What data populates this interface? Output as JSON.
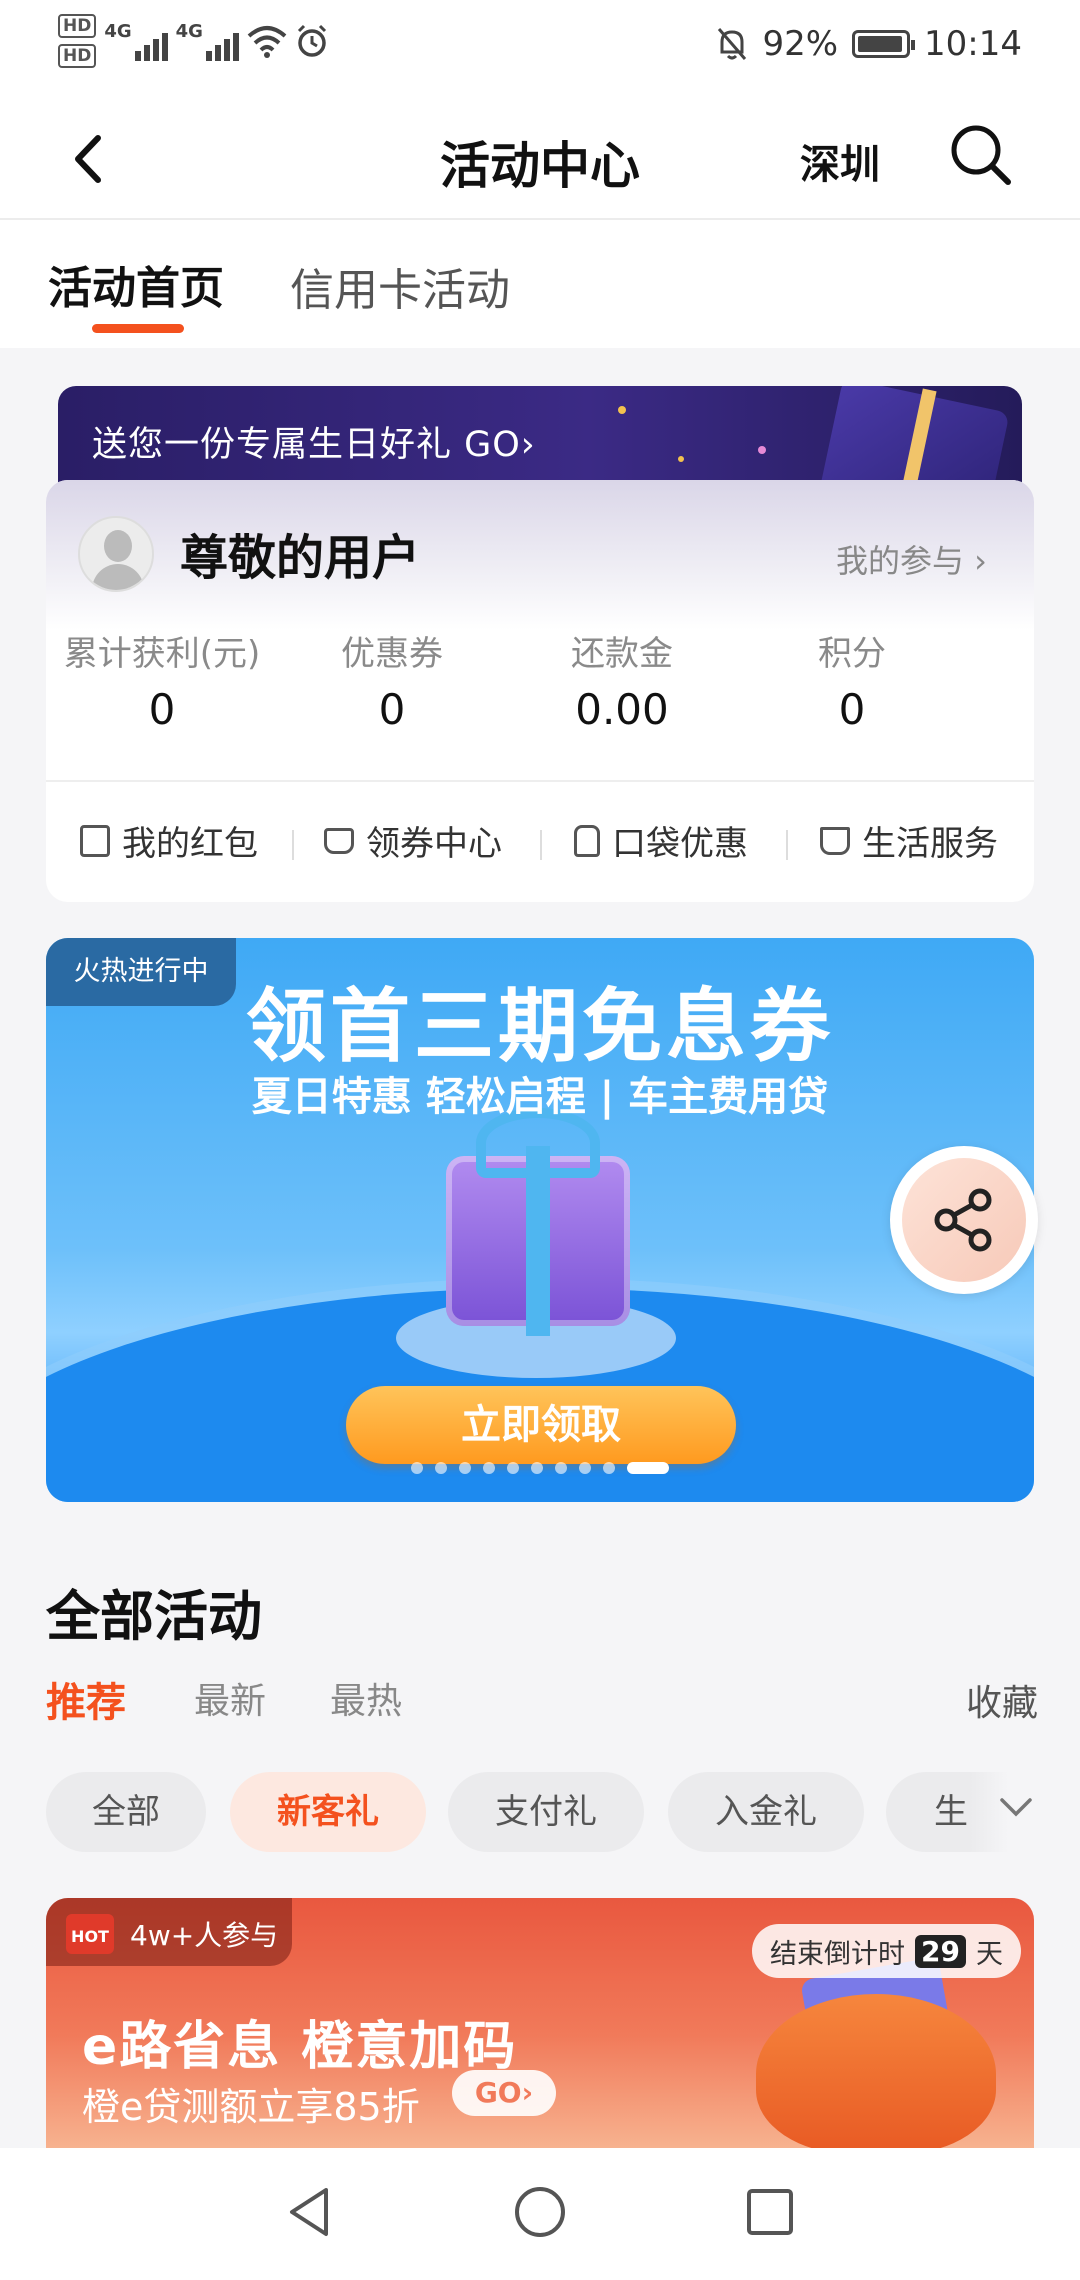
{
  "status_bar": {
    "hd1": "HD",
    "hd2": "HD",
    "net1": "4G",
    "net2": "4G",
    "battery": "92%",
    "time": "10:14"
  },
  "nav": {
    "title": "活动中心",
    "city": "深圳"
  },
  "tabs": [
    {
      "label": "活动首页",
      "active": true
    },
    {
      "label": "信用卡活动",
      "active": false
    }
  ],
  "birthday_banner": {
    "text": "送您一份专属生日好礼 GO›"
  },
  "user_card": {
    "name": "尊敬的用户",
    "my_participation": "我的参与 ›",
    "stats": [
      {
        "label": "累计获利(元)",
        "value": "0"
      },
      {
        "label": "优惠券",
        "value": "0"
      },
      {
        "label": "还款金",
        "value": "0.00"
      },
      {
        "label": "积分",
        "value": "0"
      }
    ],
    "quick_links": [
      {
        "label": "我的红包",
        "icon": "wallet-icon"
      },
      {
        "label": "领券中心",
        "icon": "coupon-icon"
      },
      {
        "label": "口袋优惠",
        "icon": "pocket-icon"
      },
      {
        "label": "生活服务",
        "icon": "cup-icon"
      }
    ]
  },
  "promo_banner": {
    "badge": "火热进行中",
    "title": "领首三期免息券",
    "subtitle": "夏日特惠 轻松启程 | 车主费用贷",
    "cta": "立即领取",
    "carousel_count": 10,
    "carousel_active_index": 9
  },
  "activities": {
    "title": "全部活动",
    "filter_tabs": [
      {
        "label": "推荐",
        "active": true
      },
      {
        "label": "最新",
        "active": false
      },
      {
        "label": "最热",
        "active": false
      }
    ],
    "favorites": "收藏",
    "chips": [
      {
        "label": "全部",
        "active": false
      },
      {
        "label": "新客礼",
        "active": true
      },
      {
        "label": "支付礼",
        "active": false
      },
      {
        "label": "入金礼",
        "active": false
      },
      {
        "label": "生",
        "active": false
      }
    ],
    "card": {
      "hot_logo": "HOT",
      "participants": "4w+人参与",
      "countdown_prefix": "结束倒计时",
      "countdown_days": "29",
      "countdown_suffix": "天",
      "title": "e路省息 橙意加码",
      "subtitle": "橙e贷测额立享85折",
      "go": "GO›"
    }
  },
  "colors": {
    "accent": "#f4511e",
    "promo_blue": "#3fa9f5",
    "birthday_purple": "#2a1e66"
  }
}
